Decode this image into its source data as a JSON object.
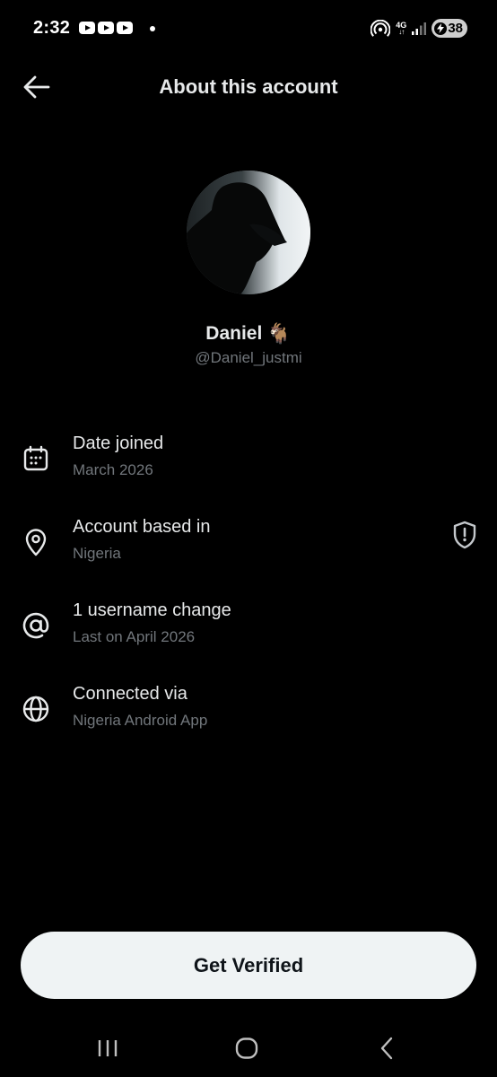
{
  "status_bar": {
    "time": "2:32",
    "network": "4G",
    "network_arrows": "↓↑",
    "battery": "38",
    "icons": [
      "youtube-icon",
      "youtube-icon",
      "youtube-icon",
      "notification-dot",
      "hotspot-icon",
      "signal-icon",
      "battery-charging-icon"
    ]
  },
  "header": {
    "title": "About this account",
    "back_icon": "arrow-left-icon"
  },
  "profile": {
    "display_name": "Daniel",
    "emoji": "🐐",
    "handle": "@Daniel_justmi"
  },
  "info": [
    {
      "icon": "calendar-icon",
      "title": "Date joined",
      "subtitle": "March 2026"
    },
    {
      "icon": "location-pin-icon",
      "title": "Account based in",
      "subtitle": "Nigeria",
      "badge_icon": "shield-alert-icon"
    },
    {
      "icon": "at-sign-icon",
      "title": "1 username change",
      "subtitle": "Last on April 2026"
    },
    {
      "icon": "globe-icon",
      "title": "Connected via",
      "subtitle": "Nigeria Android App"
    }
  ],
  "cta": {
    "label": "Get Verified"
  },
  "nav": {
    "icons": [
      "recents-icon",
      "home-icon",
      "back-icon"
    ]
  },
  "colors": {
    "background": "#000000",
    "primary_text": "#e7e9ea",
    "secondary_text": "#71767b",
    "button_bg": "#eff3f4",
    "button_text": "#0f1419"
  }
}
